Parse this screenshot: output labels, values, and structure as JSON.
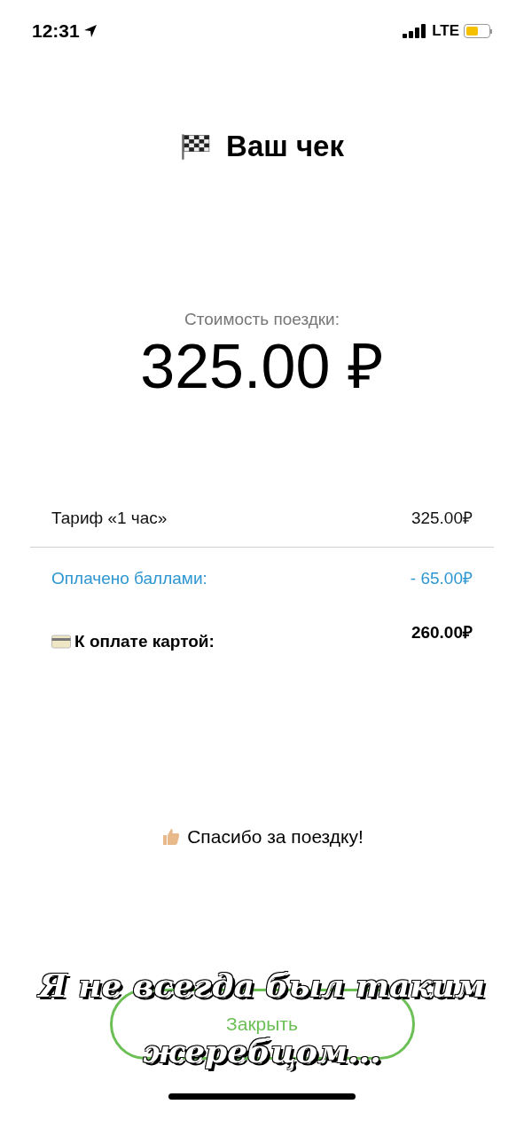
{
  "status_bar": {
    "time": "12:31",
    "network": "LTE"
  },
  "title": "Ваш чек",
  "cost": {
    "label": "Стоимость поездки:",
    "amount": "325.00 ₽"
  },
  "lines": [
    {
      "kind": "plain",
      "label": "Тариф «1 час»",
      "value": "325.00₽"
    },
    {
      "kind": "bonus",
      "label": "Оплачено баллами:",
      "value": "- 65.00₽"
    },
    {
      "kind": "total",
      "label": "К оплате картой:",
      "value": "260.00₽"
    }
  ],
  "thanks": "Спасибо за поездку!",
  "close_button": "Закрыть",
  "caption": [
    "Я не всегда был таким",
    "жеребцом..."
  ]
}
